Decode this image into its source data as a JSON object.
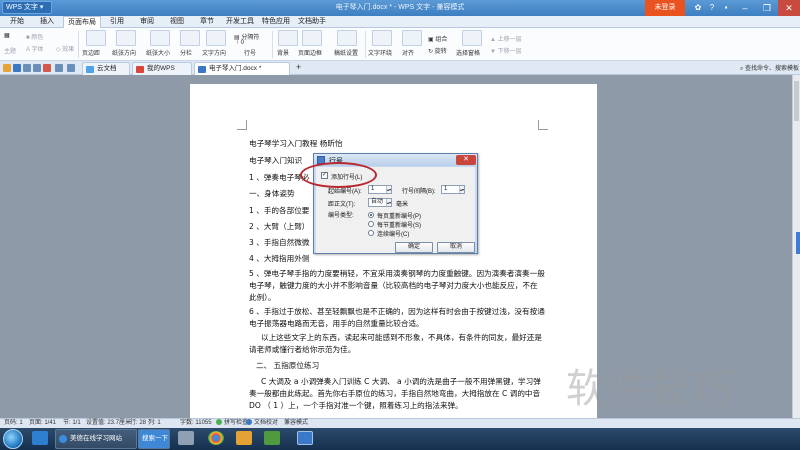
{
  "titlebar": {
    "app_name": "WPS 文字",
    "window_title": "电子琴入门.docx * - WPS 文字 - 兼容模式",
    "login_label": "未登录"
  },
  "menu": {
    "tabs": [
      {
        "label": "开始",
        "active": false
      },
      {
        "label": "插入",
        "active": false
      },
      {
        "label": "页面布局",
        "active": true
      },
      {
        "label": "引用",
        "active": false
      },
      {
        "label": "审阅",
        "active": false
      },
      {
        "label": "视图",
        "active": false
      },
      {
        "label": "章节",
        "active": false
      },
      {
        "label": "开发工具",
        "active": false
      },
      {
        "label": "特色应用",
        "active": false
      },
      {
        "label": "文档助手",
        "active": false
      }
    ]
  },
  "ribbon": {
    "theme": "主题",
    "color": "颜色",
    "font": "字体",
    "effect": "效果",
    "margins": "页边距",
    "orientation": "纸张方向",
    "size": "纸张大小",
    "columns": "分栏",
    "text_direction": "文字方向",
    "line_numbers": "行号",
    "breaks": "分隔符",
    "background": "背景",
    "page_border": "页面边框",
    "draft_settings": "稿纸设置",
    "wrap_text": "文字环绕",
    "align": "对齐",
    "combine": "组合",
    "rotate": "旋转",
    "selection_pane": "选择窗格",
    "bring_forward": "上移一层",
    "send_backward": "下移一层",
    "top_value": "0",
    "bottom_value": "0"
  },
  "tabbar": {
    "tabs": [
      {
        "label": "云文档",
        "active": false
      },
      {
        "label": "我的WPS",
        "active": false
      },
      {
        "label": "电子琴入门.docx *",
        "active": true
      }
    ],
    "add_label": "+",
    "search_placeholder": "查找命令、搜索模板"
  },
  "document": {
    "lines": [
      "电子琴学习入门教程    杨昕怡",
      "电子琴入门知识",
      "1 、弹奏电子琴必",
      "一、身体姿势",
      "1 、手的各部位要",
      "2 、大臂（上臂）",
      "3 、手指自然微微",
      "4 、大拇指用外侧"
    ],
    "para5": "5 、弹电子琴手指的力度要稍轻，不宜采用演奏钢琴的力度重触键。因为演奏者演奏一般电子琴，触键力度的大小并不影响音量（比较高档的电子琴对力度大小也能反应，不在此例）。",
    "para6": "6 、手指过于放松、甚至轻飘飘也是不正确的，因为这样有时会由于按键过浅，没有按通电子振荡器电路而无音，用手的自然重量比较合适。",
    "para7": "以上这些文字上的东西，读起来可能感到不形象，不具体，有条件的同友，最好还是请老师或懂行者给你示范为佳。",
    "heading2": "二、 五指原位练习",
    "para8": "C 大调及 a 小调弹奏入门训练   C 大调、 a 小调的洗是曲子一般不用弹黑键，学习弹奏一般都由此练起。首先你右手原位的练习，手指自然地弯曲，大拇指放在 C 调的中音 DO （ 1 ）上，一个手指对准一个键，照着练习上的指法来弹。"
  },
  "dialog": {
    "title": "行号",
    "add_line_numbers": "添加行号(L)",
    "start_at_label": "起始编号(A):",
    "start_at_value": "1",
    "count_by_label": "行号间隔(B):",
    "count_by_value": "1",
    "from_text_label": "距正文(T):",
    "from_text_value": "自动",
    "from_text_unit": "毫米",
    "numbering_label": "编号类型:",
    "options": [
      {
        "label": "每页重新编号(P)",
        "selected": true
      },
      {
        "label": "每节重新编号(S)",
        "selected": false
      },
      {
        "label": "连续编号(C)",
        "selected": false
      }
    ],
    "ok_label": "确定",
    "cancel_label": "取消"
  },
  "statusbar": {
    "page_no": "页码: 1",
    "pages": "页面: 1/41",
    "section": "节: 1/1",
    "position": "设置值: 23.7厘米",
    "row": "行: 28",
    "col": "列: 1",
    "words": "字数: 11055",
    "spell": "拼写检查",
    "doc_check": "文档校对",
    "compat": "兼容模式"
  },
  "taskbar": {
    "browser_label": "美德在线学习网站",
    "search_label": "搜索一下"
  },
  "watermark": "软件技巧",
  "colors": {
    "accent": "#3d7fc1",
    "login": "#e8531f",
    "annotation": "#b8282f"
  }
}
